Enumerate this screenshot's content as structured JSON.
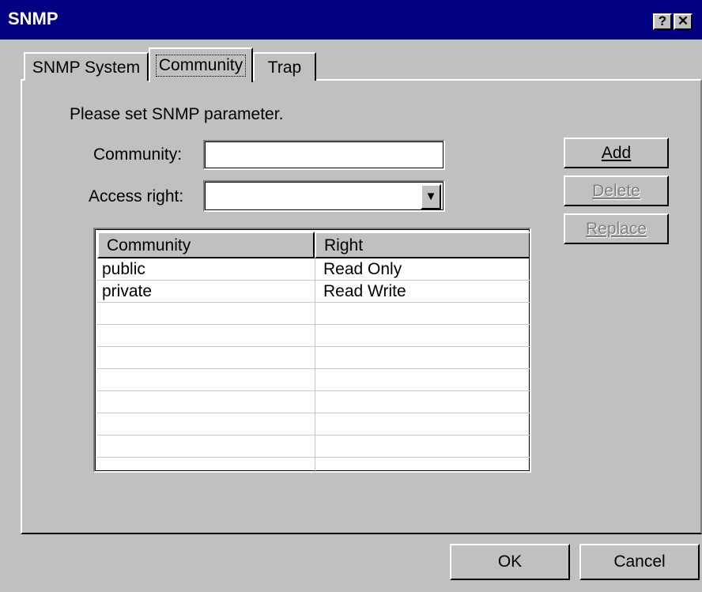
{
  "window": {
    "title": "SNMP",
    "help_label": "?",
    "close_label": "✕"
  },
  "tabs": [
    {
      "label": "SNMP System"
    },
    {
      "label": "Community"
    },
    {
      "label": "Trap"
    }
  ],
  "panel": {
    "instruction": "Please set SNMP parameter.",
    "community_label": "Community:",
    "community_value": "",
    "access_label": "Access right:",
    "access_value": "",
    "buttons": {
      "add": "Add",
      "delete": "Delete",
      "replace": "Replace"
    },
    "table": {
      "columns": [
        "Community",
        "Right"
      ],
      "rows": [
        {
          "community": "public",
          "right": "Read Only"
        },
        {
          "community": "private",
          "right": "Read Write"
        },
        {
          "community": "",
          "right": ""
        },
        {
          "community": "",
          "right": ""
        },
        {
          "community": "",
          "right": ""
        },
        {
          "community": "",
          "right": ""
        },
        {
          "community": "",
          "right": ""
        },
        {
          "community": "",
          "right": ""
        },
        {
          "community": "",
          "right": ""
        }
      ]
    }
  },
  "footer": {
    "ok": "OK",
    "cancel": "Cancel"
  },
  "icons": {
    "dropdown": "chevron-down-icon"
  },
  "colors": {
    "titlebar": "#000080",
    "face": "#c0c0c0"
  }
}
